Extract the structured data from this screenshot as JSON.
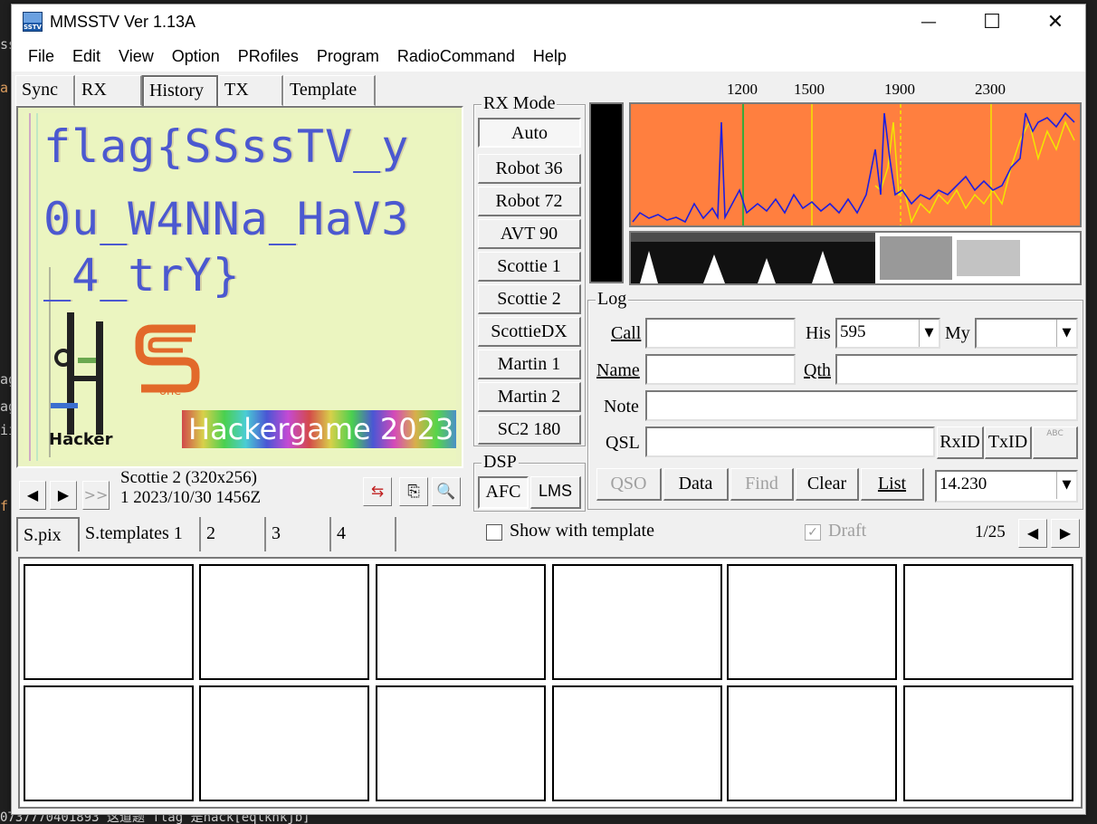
{
  "background": {
    "left_glyphs": [
      "ss",
      "a",
      "ag",
      "ag",
      "ii",
      "f"
    ],
    "bottom_text": "0737770401893 这道题 flag 是hack[eqlkhkjb]"
  },
  "window": {
    "title": "MMSSTV Ver 1.13A",
    "icon_text": "SSTV",
    "minimize": "—",
    "maximize": "☐",
    "close": "✕"
  },
  "menu": [
    {
      "label": "File"
    },
    {
      "label": "Edit"
    },
    {
      "label": "View"
    },
    {
      "label": "Option"
    },
    {
      "label": "PRofiles"
    },
    {
      "label": "Program"
    },
    {
      "label": "RadioCommand"
    },
    {
      "label": "Help"
    }
  ],
  "top_tabs": [
    "Sync",
    "RX",
    "History",
    "TX",
    "Template"
  ],
  "active_top_tab": "History",
  "picture": {
    "lines": [
      "flag{SSssTV_y",
      "0u_W4NNa_HaV3",
      "_4_trY}"
    ],
    "banner": "Hackergame 2023",
    "logo_text": "Hacker",
    "logo_small": "one"
  },
  "picture_info": {
    "mode": "Scottie 2 (320x256)",
    "stamp": "1 2023/10/30 1456Z"
  },
  "nav": {
    "prev": "◀",
    "next": "▶",
    "skip": ">>"
  },
  "tools": {
    "send": "⇆",
    "copy": "⎘",
    "zoom": "🔍"
  },
  "rx_mode": {
    "label": "RX Mode",
    "modes": [
      "Auto",
      "Robot 36",
      "Robot 72",
      "AVT 90",
      "Scottie 1",
      "Scottie 2",
      "ScottieDX",
      "Martin 1",
      "Martin 2",
      "SC2 180"
    ],
    "selected": "Auto"
  },
  "dsp": {
    "label": "DSP",
    "afc": "AFC",
    "lms": "LMS"
  },
  "spectrum": {
    "freq_labels": [
      "1200",
      "1500",
      "1900",
      "2300"
    ],
    "bg_color": "#ff7f3f",
    "trace_color": "#1e1ee0",
    "overlay_color": "#f2e600"
  },
  "log": {
    "label": "Log",
    "call_label": "Call",
    "call_value": "",
    "his_label": "His",
    "his_value": "595",
    "my_label": "My",
    "my_value": "",
    "name_label": "Name",
    "name_value": "",
    "qth_label": "Qth",
    "qth_value": "",
    "note_label": "Note",
    "note_value": "",
    "qsl_label": "QSL",
    "qsl_value": "",
    "rxid": "RxID",
    "txid": "TxID",
    "abc": "ABC",
    "buttons": {
      "qso": "QSO",
      "data": "Data",
      "find": "Find",
      "clear": "Clear",
      "list": "List"
    },
    "freq": "14.230"
  },
  "lower_tabs": [
    "S.pix",
    "S.templates 1",
    "2",
    "3",
    "4"
  ],
  "active_lower_tab": "S.pix",
  "show_template": {
    "label": "Show with template",
    "checked": false
  },
  "draft": {
    "label": "Draft",
    "checked": true
  },
  "page_counter": "1/25",
  "thumbs_count": 12
}
